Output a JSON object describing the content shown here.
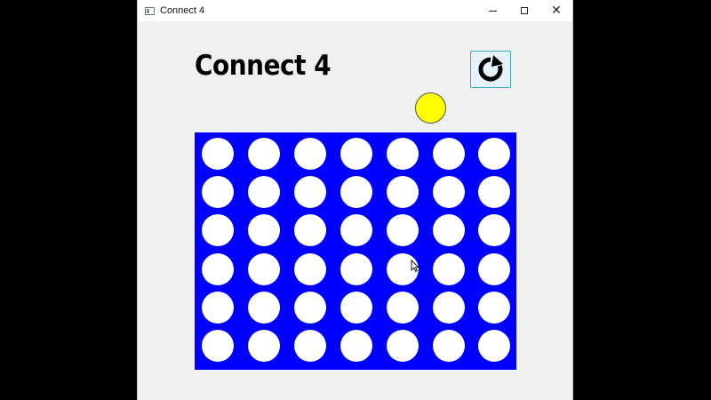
{
  "window": {
    "title": "Connect 4",
    "controls": {
      "minimize": "minimize",
      "maximize": "maximize",
      "close": "close"
    }
  },
  "game": {
    "title": "Connect 4",
    "rows": 6,
    "columns": 7,
    "current_player_color": "#ffff00",
    "board_color": "#0000ff",
    "empty_cell_color": "#ffffff",
    "hover_column": 5,
    "reset_icon": "refresh-icon",
    "cells": [
      [
        "empty",
        "empty",
        "empty",
        "empty",
        "empty",
        "empty",
        "empty"
      ],
      [
        "empty",
        "empty",
        "empty",
        "empty",
        "empty",
        "empty",
        "empty"
      ],
      [
        "empty",
        "empty",
        "empty",
        "empty",
        "empty",
        "empty",
        "empty"
      ],
      [
        "empty",
        "empty",
        "empty",
        "empty",
        "empty",
        "empty",
        "empty"
      ],
      [
        "empty",
        "empty",
        "empty",
        "empty",
        "empty",
        "empty",
        "empty"
      ],
      [
        "empty",
        "empty",
        "empty",
        "empty",
        "empty",
        "empty",
        "empty"
      ]
    ]
  }
}
